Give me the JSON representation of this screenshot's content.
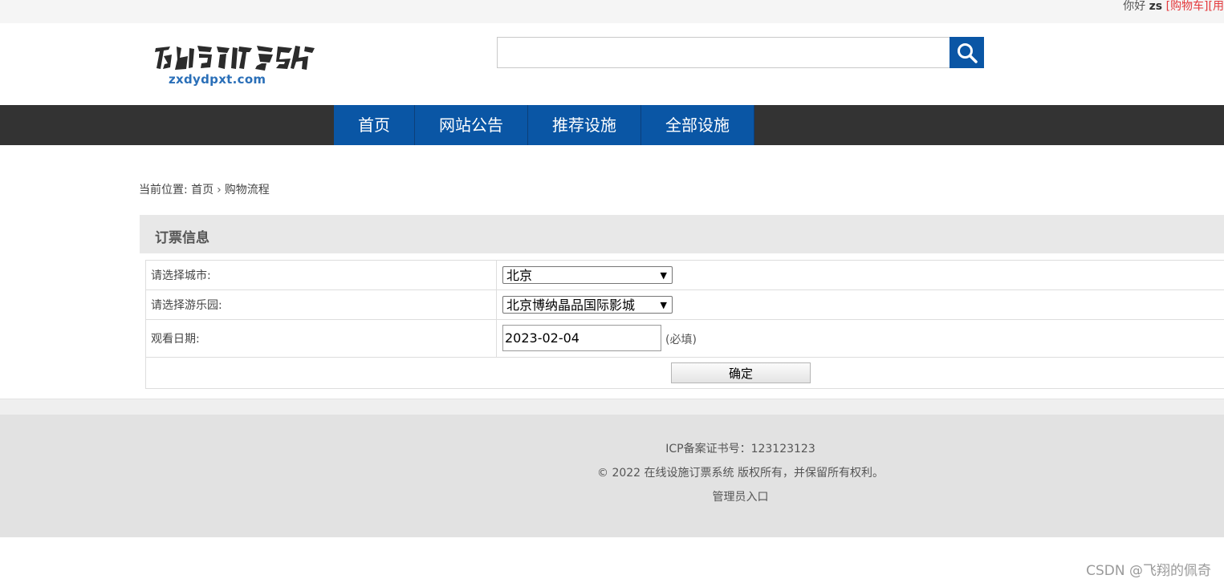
{
  "topbar": {
    "greeting": "你好 ",
    "username": "zs",
    "cart_link": "[购物车]",
    "extra_link": "[用"
  },
  "header": {
    "logo_domain": "zxdydpxt.com",
    "search_value": ""
  },
  "nav": {
    "items": [
      {
        "label": "首页"
      },
      {
        "label": "网站公告"
      },
      {
        "label": "推荐设施"
      },
      {
        "label": "全部设施"
      }
    ]
  },
  "breadcrumb": {
    "prefix": "当前位置: ",
    "home": "首页",
    "current": "购物流程"
  },
  "order": {
    "section_title": "订票信息",
    "city_label": "请选择城市:",
    "city_value": "北京",
    "park_label": "请选择游乐园:",
    "park_value": "北京博纳晶品国际影城",
    "date_label": "观看日期:",
    "date_value": "2023-02-04",
    "required_note": "(必填)",
    "confirm_label": "确定"
  },
  "footer": {
    "icp": "ICP备案证书号：123123123",
    "copyright": "© 2022 在线设施订票系统 版权所有，并保留所有权利。",
    "admin_link": "管理员入口"
  },
  "watermark": "CSDN @飞翔的佩奇",
  "colors": {
    "primary_blue": "#0a56a5",
    "nav_dark": "#333333",
    "link_red": "#e4393c"
  }
}
